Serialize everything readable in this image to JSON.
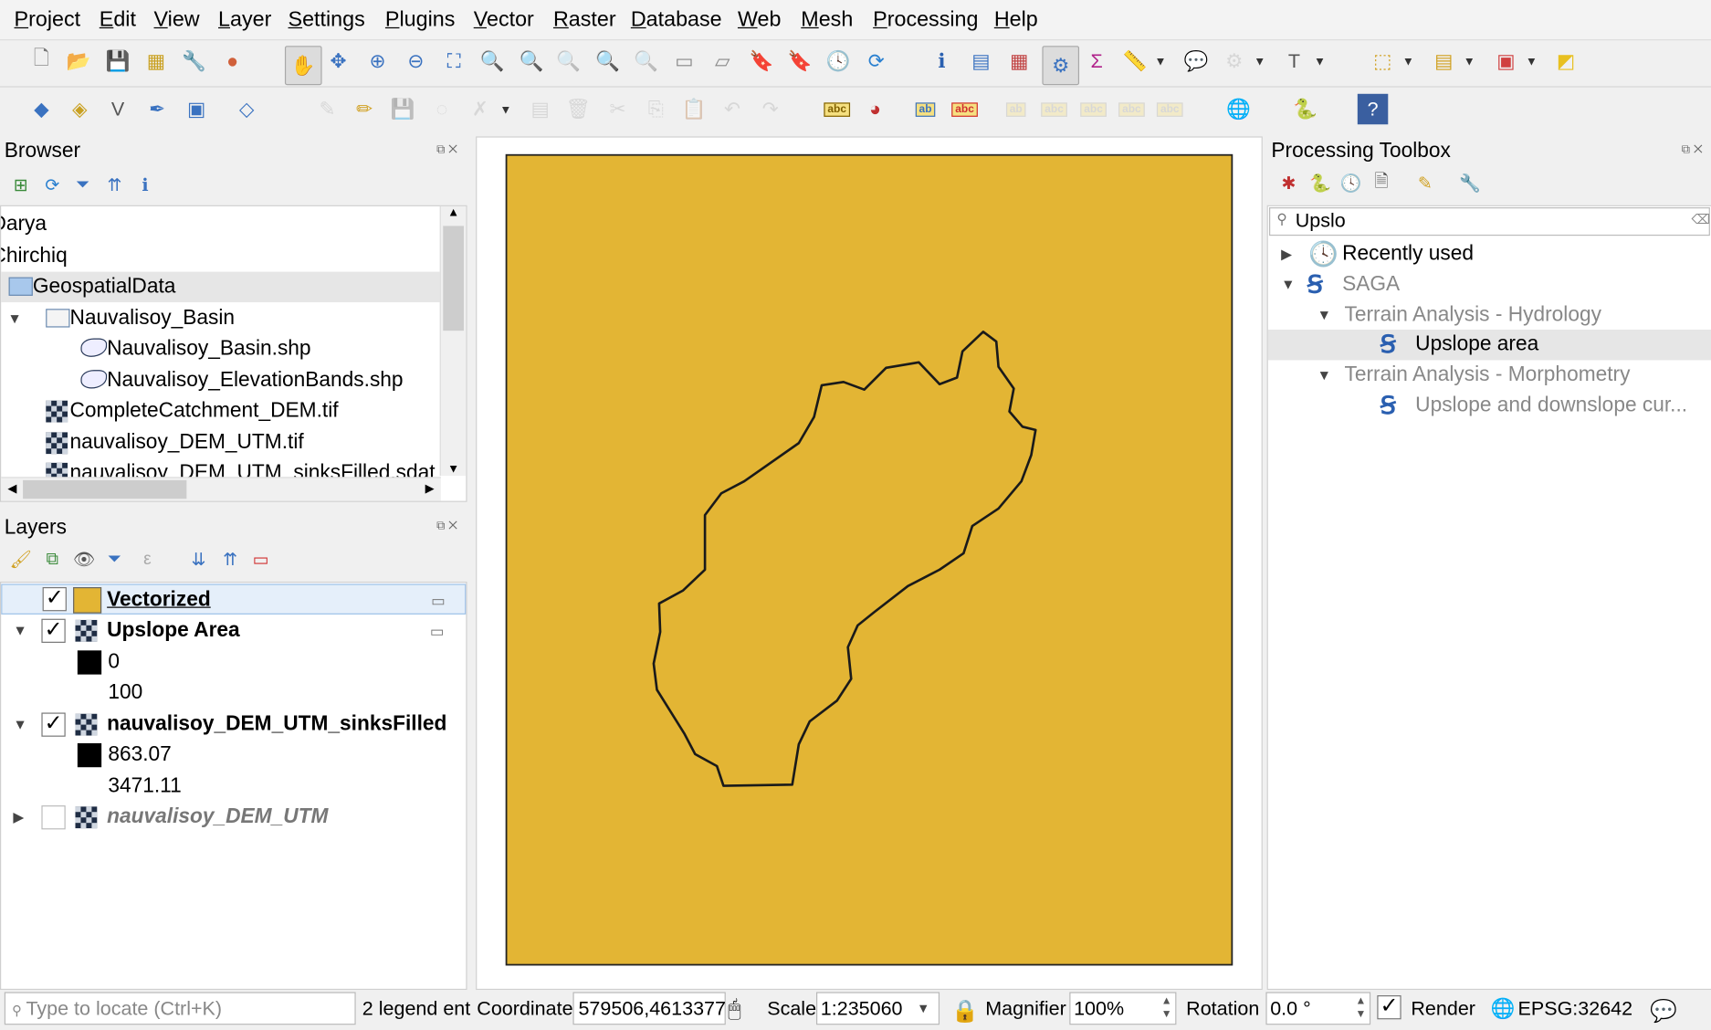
{
  "menu": [
    "Project",
    "Edit",
    "View",
    "Layer",
    "Settings",
    "Plugins",
    "Vector",
    "Raster",
    "Database",
    "Web",
    "Mesh",
    "Processing",
    "Help"
  ],
  "toolbar1": [
    {
      "icon": "new-project-icon",
      "g": "🗋",
      "c": "#777"
    },
    {
      "icon": "open-project-icon",
      "g": "📂",
      "c": "#e8b820"
    },
    {
      "icon": "save-project-icon",
      "g": "💾",
      "c": "#4a6a9a"
    },
    {
      "icon": "new-print-layout-icon",
      "g": "▦",
      "c": "#c9a020"
    },
    {
      "icon": "layout-manager-icon",
      "g": "🔧",
      "c": "#666"
    },
    {
      "icon": "style-manager-icon",
      "g": "●",
      "c": "#d0603a"
    },
    {
      "icon": "pan-icon",
      "g": "✋",
      "c": "#333",
      "pressed": true
    },
    {
      "icon": "pan-to-selection-icon",
      "g": "✥",
      "c": "#3a72c0"
    },
    {
      "icon": "zoom-in-icon",
      "g": "⊕",
      "c": "#3a72c0"
    },
    {
      "icon": "zoom-out-icon",
      "g": "⊖",
      "c": "#3a72c0"
    },
    {
      "icon": "zoom-full-icon",
      "g": "⛶",
      "c": "#3a72c0"
    },
    {
      "icon": "zoom-to-selection-icon",
      "g": "🔍",
      "c": "#c9a020"
    },
    {
      "icon": "zoom-to-layer-icon",
      "g": "🔍",
      "c": "#666"
    },
    {
      "icon": "zoom-native-icon",
      "g": "🔍",
      "c": "#aaa",
      "dis": true
    },
    {
      "icon": "zoom-last-icon",
      "g": "🔍",
      "c": "#3a72c0"
    },
    {
      "icon": "zoom-next-icon",
      "g": "🔍",
      "c": "#aaa",
      "dis": true
    },
    {
      "icon": "new-map-view-icon",
      "g": "▭",
      "c": "#888"
    },
    {
      "icon": "new-3d-map-icon",
      "g": "▱",
      "c": "#888"
    },
    {
      "icon": "new-bookmark-icon",
      "g": "🔖",
      "c": "#3a72c0"
    },
    {
      "icon": "show-bookmarks-icon",
      "g": "🔖",
      "c": "#888"
    },
    {
      "icon": "temporal-controller-icon",
      "g": "🕓",
      "c": "#555"
    },
    {
      "icon": "refresh-icon",
      "g": "⟳",
      "c": "#2a80d0"
    },
    {
      "icon": "identify-icon",
      "g": "ℹ",
      "c": "#2a60b0"
    },
    {
      "icon": "attribute-table-icon",
      "g": "▤",
      "c": "#3a72c0"
    },
    {
      "icon": "field-calculator-icon",
      "g": "▦",
      "c": "#c04040"
    },
    {
      "icon": "processing-toolbox-icon",
      "g": "⚙",
      "c": "#3a72c0",
      "pressed": true
    },
    {
      "icon": "statistical-summary-icon",
      "g": "Σ",
      "c": "#b0208a"
    },
    {
      "icon": "measure-icon",
      "g": "📏",
      "c": "#555",
      "drop": true
    },
    {
      "icon": "map-tips-icon",
      "g": "💬",
      "c": "#e8c020"
    },
    {
      "icon": "locator-icon",
      "g": "⚙",
      "c": "#aaa",
      "drop": true,
      "dis": true
    },
    {
      "icon": "text-annotation-icon",
      "g": "T",
      "c": "#555",
      "drop": true
    },
    {
      "icon": "select-features-icon",
      "g": "⬚",
      "c": "#d0a020",
      "drop": true
    },
    {
      "icon": "select-by-value-icon",
      "g": "▤",
      "c": "#d0a020",
      "drop": true
    },
    {
      "icon": "deselect-icon",
      "g": "▣",
      "c": "#d04040",
      "drop": true
    },
    {
      "icon": "select-location-icon",
      "g": "◩",
      "c": "#e8c020"
    }
  ],
  "toolbar2": [
    {
      "icon": "data-source-manager-icon",
      "g": "◆",
      "c": "#3a72c0"
    },
    {
      "icon": "new-geopackage-layer-icon",
      "g": "◈",
      "c": "#c9a020"
    },
    {
      "icon": "new-shapefile-layer-icon",
      "g": "V",
      "c": "#555"
    },
    {
      "icon": "new-spatialite-layer-icon",
      "g": "✒",
      "c": "#3a72c0"
    },
    {
      "icon": "new-virtual-layer-icon",
      "g": "▣",
      "c": "#3a72c0"
    },
    {
      "icon": "new-mesh-layer-icon",
      "g": "◇",
      "c": "#3a72c0"
    },
    {
      "icon": "current-edits-icon",
      "g": "✎",
      "c": "#aaa",
      "dis": true
    },
    {
      "icon": "toggle-editing-icon",
      "g": "✏",
      "c": "#d0a020"
    },
    {
      "icon": "save-edits-icon",
      "g": "💾",
      "c": "#aaa",
      "dis": true
    },
    {
      "icon": "add-feature-icon",
      "g": "◌",
      "c": "#aaa",
      "dis": true
    },
    {
      "icon": "vertex-tool-icon",
      "g": "✗",
      "c": "#aaa",
      "dis": true,
      "drop": true
    },
    {
      "icon": "modify-attributes-icon",
      "g": "▤",
      "c": "#aaa",
      "dis": true
    },
    {
      "icon": "delete-selected-icon",
      "g": "🗑",
      "c": "#aaa",
      "dis": true
    },
    {
      "icon": "cut-features-icon",
      "g": "✂",
      "c": "#aaa",
      "dis": true
    },
    {
      "icon": "copy-features-icon",
      "g": "⎘",
      "c": "#aaa",
      "dis": true
    },
    {
      "icon": "paste-features-icon",
      "g": "📋",
      "c": "#aaa",
      "dis": true
    },
    {
      "icon": "undo-icon",
      "g": "↶",
      "c": "#aaa",
      "dis": true
    },
    {
      "icon": "redo-icon",
      "g": "↷",
      "c": "#aaa",
      "dis": true
    },
    {
      "icon": "label-toolbar-icon",
      "g": "abc",
      "c": "#806000"
    },
    {
      "icon": "diagram-icon",
      "g": "◕",
      "c": "#c03030"
    },
    {
      "icon": "pin-labels-icon",
      "g": "ab",
      "c": "#3a72c0"
    },
    {
      "icon": "show-hide-labels-icon",
      "g": "abc",
      "c": "#d03030"
    },
    {
      "icon": "move-label-icon",
      "g": "ab",
      "c": "#aaa",
      "dis": true
    },
    {
      "icon": "rotate-label-icon",
      "g": "abc",
      "c": "#aaa",
      "dis": true
    },
    {
      "icon": "change-label-icon",
      "g": "abc",
      "c": "#aaa",
      "dis": true
    },
    {
      "icon": "label-properties-icon",
      "g": "abc",
      "c": "#aaa",
      "dis": true
    },
    {
      "icon": "label-rules-icon",
      "g": "abc",
      "c": "#aaa",
      "dis": true
    },
    {
      "icon": "plugin-globe-icon",
      "g": "🌐",
      "c": "#333"
    },
    {
      "icon": "python-console-icon",
      "g": "🐍",
      "c": "#3a72c0"
    },
    {
      "icon": "help-icon",
      "g": "?",
      "c": "#fff"
    }
  ],
  "browser": {
    "title": "Browser",
    "toolbar": [
      "add-selected-icon",
      "refresh-icon",
      "filter-icon",
      "collapse-all-icon",
      "properties-icon"
    ],
    "items": [
      {
        "label": "Darya",
        "indent": 0,
        "icon": "none"
      },
      {
        "label": "Chirchiq",
        "indent": 0,
        "icon": "none"
      },
      {
        "label": "GeospatialData",
        "indent": 1,
        "icon": "folder",
        "selected": true
      },
      {
        "label": "Nauvalisoy_Basin",
        "indent": 2,
        "icon": "folder",
        "expanded": true
      },
      {
        "label": "Nauvalisoy_Basin.shp",
        "indent": 3,
        "icon": "polygon"
      },
      {
        "label": "Nauvalisoy_ElevationBands.shp",
        "indent": 3,
        "icon": "polygon"
      },
      {
        "label": "CompleteCatchment_DEM.tif",
        "indent": 2,
        "icon": "raster"
      },
      {
        "label": "nauvalisoy_DEM_UTM.tif",
        "indent": 2,
        "icon": "raster"
      },
      {
        "label": "nauvalisoy_DEM_UTM_sinksFilled.sdat",
        "indent": 2,
        "icon": "raster"
      }
    ]
  },
  "layers": {
    "title": "Layers",
    "toolbar": [
      "style-manager-icon",
      "add-group-icon",
      "manage-visibility-icon",
      "filter-legend-icon",
      "filter-expression-icon",
      "expand-all-icon",
      "collapse-all-icon",
      "remove-layer-icon"
    ],
    "vectorized": {
      "name": "Vectorized",
      "checked": true,
      "color": "#e3b534"
    },
    "upslope": {
      "name": "Upslope Area",
      "checked": true,
      "min": "0",
      "max": "100"
    },
    "sinks": {
      "name": "nauvalisoy_DEM_UTM_sinksFilled",
      "checked": true,
      "min": "863.07",
      "max": "3471.11"
    },
    "dem": {
      "name": "nauvalisoy_DEM_UTM",
      "checked": false
    }
  },
  "map": {
    "fill": "#e3b534",
    "outline": "#1a1a1a"
  },
  "processing": {
    "title": "Processing Toolbox",
    "toolbar": [
      "models-icon",
      "scripts-icon",
      "history-icon",
      "results-viewer-icon",
      "edit-features-in-place-icon",
      "options-icon"
    ],
    "search": "Upslo",
    "tree": {
      "recent": "Recently used",
      "saga": "SAGA",
      "hydro": "Terrain Analysis - Hydrology",
      "upslope": "Upslope area",
      "morpho": "Terrain Analysis - Morphometry",
      "updown": "Upslope and downslope cur..."
    }
  },
  "status": {
    "locate_placeholder": "Type to locate (Ctrl+K)",
    "legend": "2 legend ent",
    "coord_label": "Coordinate",
    "coord": "579506,4613377",
    "scale_label": "Scale",
    "scale": "1:235060",
    "magnifier_label": "Magnifier",
    "magnifier": "100%",
    "rotation_label": "Rotation",
    "rotation": "0.0 °",
    "render_label": "Render",
    "render": true,
    "crs": "EPSG:32642"
  }
}
